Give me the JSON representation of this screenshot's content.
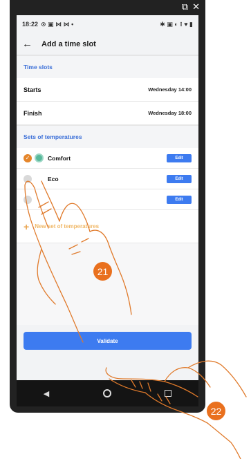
{
  "statusbar": {
    "time": "18:22",
    "left_icons": "⊙ ▣ ⋈ ⋈ •",
    "right_icons": "✱ ▣ ◐ ⁝ ♥ ▮"
  },
  "header": {
    "back_icon": "←",
    "title": "Add a time slot"
  },
  "time_slots": {
    "heading": "Time slots",
    "rows": [
      {
        "label": "Starts",
        "value": "Wednesday 14:00"
      },
      {
        "label": "Finish",
        "value": "Wednesday 18:00"
      }
    ]
  },
  "temperatures": {
    "heading": "Sets of temperatures",
    "items": [
      {
        "label": "Comfort",
        "selected": true,
        "edit_label": "Edit"
      },
      {
        "label": "Eco",
        "selected": false,
        "edit_label": "Edit"
      },
      {
        "label": "",
        "selected": false,
        "edit_label": "Edit"
      }
    ],
    "new_set_label": "New set of temperatures"
  },
  "validate_label": "Validate",
  "step_badges": [
    "21",
    "22"
  ],
  "colors": {
    "accent": "#3d7bf0",
    "heading": "#3b6fd8",
    "badge": "#e9701e",
    "check": "#e5862b"
  }
}
